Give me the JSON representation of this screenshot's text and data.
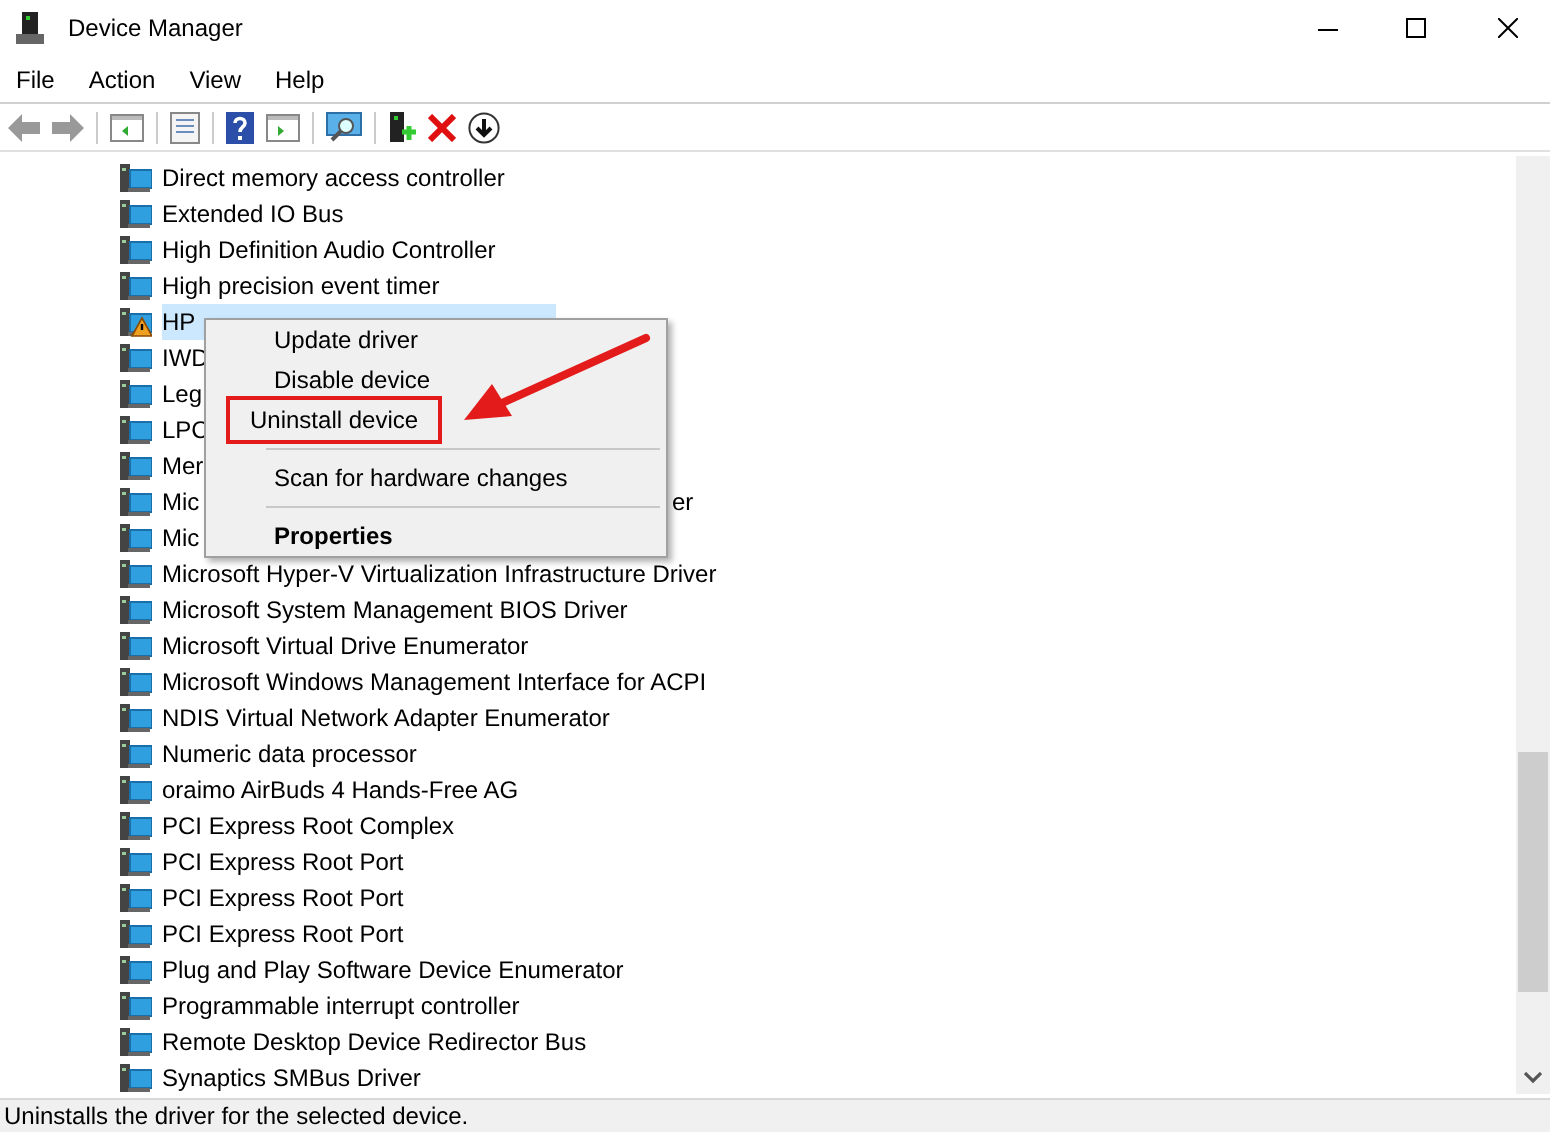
{
  "window": {
    "title": "Device Manager"
  },
  "menu_bar": [
    "File",
    "Action",
    "View",
    "Help"
  ],
  "tree_items": [
    {
      "text": "Direct memory access controller",
      "selected": false,
      "warning": false
    },
    {
      "text": "Extended IO Bus",
      "selected": false,
      "warning": false
    },
    {
      "text": "High Definition Audio Controller",
      "selected": false,
      "warning": false
    },
    {
      "text": "High precision event timer",
      "selected": false,
      "warning": false
    },
    {
      "text": "HP",
      "selected": true,
      "warning": true
    },
    {
      "text": "IWD",
      "selected": false,
      "warning": false
    },
    {
      "text": "Leg",
      "selected": false,
      "warning": false
    },
    {
      "text": "LPC",
      "selected": false,
      "warning": false
    },
    {
      "text": "Mer",
      "selected": false,
      "warning": false
    },
    {
      "text": "Mic",
      "selected": false,
      "warning": false,
      "text_end": "er"
    },
    {
      "text": "Mic",
      "selected": false,
      "warning": false
    },
    {
      "text": "Microsoft Hyper-V Virtualization Infrastructure Driver",
      "selected": false,
      "warning": false
    },
    {
      "text": "Microsoft System Management BIOS Driver",
      "selected": false,
      "warning": false
    },
    {
      "text": "Microsoft Virtual Drive Enumerator",
      "selected": false,
      "warning": false
    },
    {
      "text": "Microsoft Windows Management Interface for ACPI",
      "selected": false,
      "warning": false
    },
    {
      "text": "NDIS Virtual Network Adapter Enumerator",
      "selected": false,
      "warning": false
    },
    {
      "text": "Numeric data processor",
      "selected": false,
      "warning": false
    },
    {
      "text": "oraimo AirBuds 4 Hands-Free AG",
      "selected": false,
      "warning": false
    },
    {
      "text": "PCI Express Root Complex",
      "selected": false,
      "warning": false
    },
    {
      "text": "PCI Express Root Port",
      "selected": false,
      "warning": false
    },
    {
      "text": "PCI Express Root Port",
      "selected": false,
      "warning": false
    },
    {
      "text": "PCI Express Root Port",
      "selected": false,
      "warning": false
    },
    {
      "text": "Plug and Play Software Device Enumerator",
      "selected": false,
      "warning": false
    },
    {
      "text": "Programmable interrupt controller",
      "selected": false,
      "warning": false
    },
    {
      "text": "Remote Desktop Device Redirector Bus",
      "selected": false,
      "warning": false
    },
    {
      "text": "Synaptics SMBus Driver",
      "selected": false,
      "warning": false
    }
  ],
  "context_menu": [
    {
      "kind": "item",
      "label": "Update driver",
      "highlighted": false,
      "bold": false
    },
    {
      "kind": "item",
      "label": "Disable device",
      "highlighted": false,
      "bold": false
    },
    {
      "kind": "item",
      "label": "Uninstall device",
      "highlighted": true,
      "bold": false
    },
    {
      "kind": "separator"
    },
    {
      "kind": "item",
      "label": "Scan for hardware changes",
      "highlighted": false,
      "bold": false
    },
    {
      "kind": "separator"
    },
    {
      "kind": "item",
      "label": "Properties",
      "highlighted": false,
      "bold": true
    }
  ],
  "status_bar": "Uninstalls the driver for the selected device."
}
